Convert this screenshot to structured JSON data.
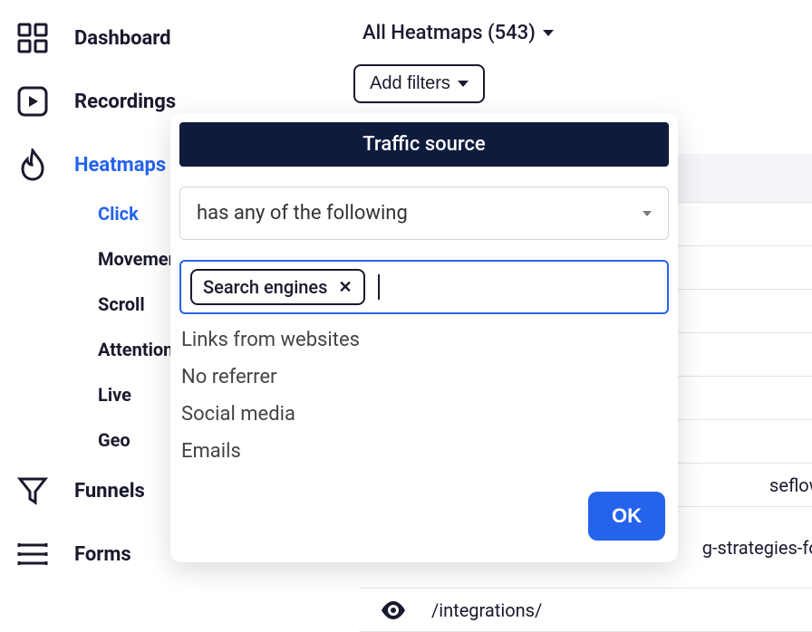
{
  "sidebar": {
    "items": [
      {
        "label": "Dashboard"
      },
      {
        "label": "Recordings"
      },
      {
        "label": "Heatmaps"
      },
      {
        "label": "Funnels"
      },
      {
        "label": "Forms"
      }
    ],
    "heatmap_subitems": [
      {
        "label": "Click"
      },
      {
        "label": "Movement"
      },
      {
        "label": "Scroll"
      },
      {
        "label": "Attention"
      },
      {
        "label": "Live"
      },
      {
        "label": "Geo"
      }
    ]
  },
  "top": {
    "selector_label": "All Heatmaps (543)",
    "add_filters_label": "Add filters"
  },
  "filter_popup": {
    "title": "Traffic source",
    "condition": "has any of the following",
    "selected_chip": "Search engines",
    "options": [
      "Links from websites",
      "No referrer",
      "Social media",
      "Emails"
    ],
    "ok_label": "OK"
  },
  "background_rows": {
    "partial1": "seflow/",
    "partial2": "g-strategies-for-",
    "row3": "/integrations/"
  }
}
